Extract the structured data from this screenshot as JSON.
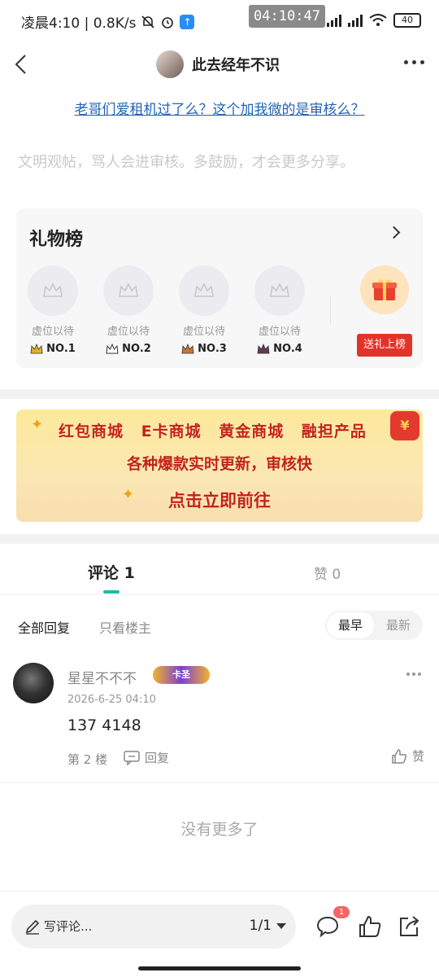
{
  "status_bar": {
    "left_text": "凌晨4:10 | 0.8K/s",
    "overlay_time": "04:10:47",
    "battery": "40"
  },
  "nav": {
    "title": "此去经年不识"
  },
  "post": {
    "title": "老哥们爱租机过了么？这个加我微的是审核么？",
    "tip": "文明观帖，骂人会进审核。多鼓励，才会更多分享。"
  },
  "gift_board": {
    "title": "礼物榜",
    "slots": [
      {
        "label": "虚位以待",
        "rank": "NO.1",
        "crown_color": "#e0b22a"
      },
      {
        "label": "虚位以待",
        "rank": "NO.2",
        "crown_color": "#6b6f7a"
      },
      {
        "label": "虚位以待",
        "rank": "NO.3",
        "crown_color": "#c8743a"
      },
      {
        "label": "虚位以待",
        "rank": "NO.4",
        "crown_color": "#5e3b55"
      }
    ],
    "button": "送礼上榜"
  },
  "banner": {
    "row1": "红包商城 E卡商城 黄金商城 融担产品",
    "row2": "各种爆款实时更新，审核快",
    "row3": "点击立即前往"
  },
  "tabs": {
    "comments": "评论 1",
    "likes": "赞 0"
  },
  "filter": {
    "all": "全部回复",
    "host_only": "只看楼主",
    "sort_earliest": "最早",
    "sort_latest": "最新"
  },
  "comments": [
    {
      "username": "星星不不不",
      "badge": "卡圣",
      "time": "2026-6-25 04:10",
      "text": "137 4148",
      "floor": "第 2 楼",
      "reply": "回复",
      "like": "赞"
    }
  ],
  "end_text": "没有更多了",
  "bottom": {
    "placeholder": "写评论...",
    "pager": "1/1",
    "comment_badge": "1"
  },
  "colors": {
    "accent": "#1db9a0",
    "link": "#2464b4",
    "red": "#e2332a"
  }
}
